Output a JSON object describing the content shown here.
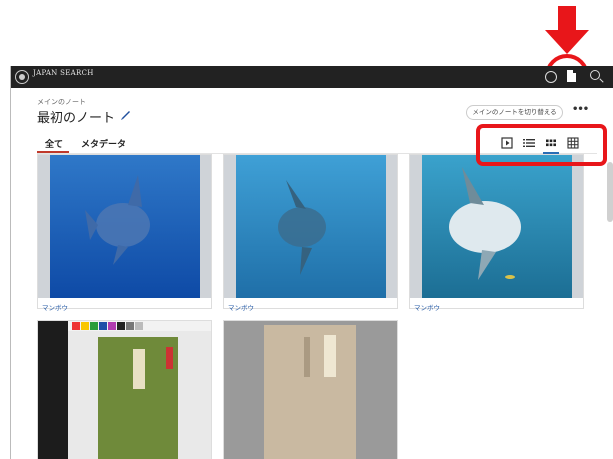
{
  "app": {
    "logo_text": "JAPAN SEARCH"
  },
  "note": {
    "breadcrumb": "メインのノート",
    "title": "最初のノート",
    "switch_label": "メインのノートを切り替える",
    "more_label": "•••"
  },
  "tabs": [
    {
      "label": "全て"
    },
    {
      "label": "メタデータ"
    }
  ],
  "views": {
    "icons": [
      "slideshow-view-icon",
      "list-view-icon",
      "medium-grid-view-icon",
      "large-grid-view-icon"
    ],
    "selected": "medium-grid-view-icon"
  },
  "cards": [
    {
      "caption": "マンボウ"
    },
    {
      "caption": "マンボウ"
    },
    {
      "caption": "マンボウ"
    },
    {
      "caption": ""
    },
    {
      "caption": ""
    }
  ],
  "colors": {
    "annotation": "#e8161a",
    "accent_tab": "#c0392b",
    "accent_view": "#2a6db5",
    "topbar": "#222222"
  }
}
